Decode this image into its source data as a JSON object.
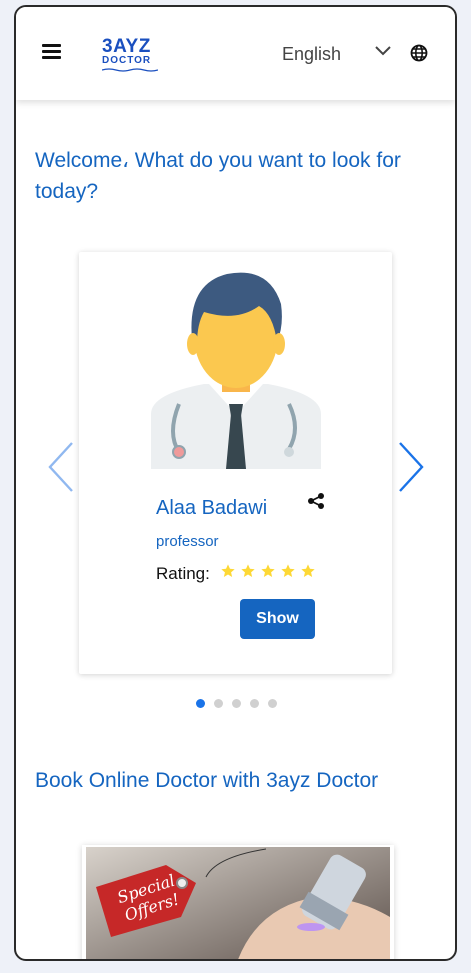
{
  "header": {
    "logo_line1": "3AYZ",
    "logo_line2": "DOCTOR",
    "language": "English",
    "menu_icon": "hamburger-icon",
    "chevron_icon": "chevron-down-icon",
    "globe_icon": "globe-icon"
  },
  "welcome": "Welcome، What do you want to look for today?",
  "carousel": {
    "doctor": {
      "name": "Alaa Badawi",
      "title": "professor",
      "rating_label": "Rating:",
      "rating": 5,
      "show_label": "Show"
    },
    "slides": 5,
    "active_slide": 1
  },
  "book_title": "Book Online Doctor with 3ayz Doctor",
  "promo": {
    "tag_line1": "Special",
    "tag_line2": "Offers!"
  },
  "colors": {
    "primary": "#1565c0",
    "dot_active": "#1a73e8",
    "star": "#fdd835"
  }
}
